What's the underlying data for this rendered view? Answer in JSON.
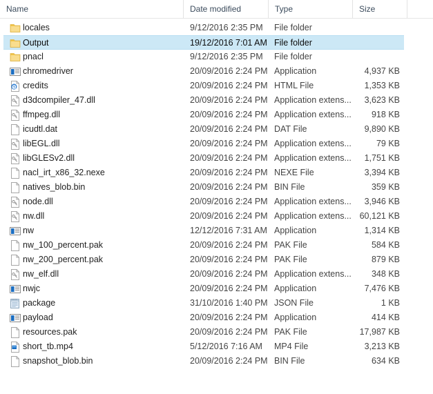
{
  "columns": {
    "name": "Name",
    "date_modified": "Date modified",
    "type": "Type",
    "size": "Size"
  },
  "colors": {
    "selection_fill": "#cce8f6",
    "selection_border": "#b9dff2",
    "folder_icon": "#f7d57f",
    "header_text": "#3b4b5c",
    "row_text": "#1f1f1f",
    "app_icon_blue": "#1b6ec2"
  },
  "files": [
    {
      "name": "locales",
      "date": "9/12/2016 2:35 PM",
      "type": "File folder",
      "size": "",
      "icon": "folder-icon",
      "selected": false
    },
    {
      "name": "Output",
      "date": "19/12/2016 7:01 AM",
      "type": "File folder",
      "size": "",
      "icon": "folder-icon",
      "selected": true
    },
    {
      "name": "pnacl",
      "date": "9/12/2016 2:35 PM",
      "type": "File folder",
      "size": "",
      "icon": "folder-icon",
      "selected": false
    },
    {
      "name": "chromedriver",
      "date": "20/09/2016 2:24 PM",
      "type": "Application",
      "size": "4,937 KB",
      "icon": "application-icon",
      "selected": false
    },
    {
      "name": "credits",
      "date": "20/09/2016 2:24 PM",
      "type": "HTML File",
      "size": "1,353 KB",
      "icon": "html-file-icon",
      "selected": false
    },
    {
      "name": "d3dcompiler_47.dll",
      "date": "20/09/2016 2:24 PM",
      "type": "Application extens...",
      "size": "3,623 KB",
      "icon": "dll-file-icon",
      "selected": false
    },
    {
      "name": "ffmpeg.dll",
      "date": "20/09/2016 2:24 PM",
      "type": "Application extens...",
      "size": "918 KB",
      "icon": "dll-file-icon",
      "selected": false
    },
    {
      "name": "icudtl.dat",
      "date": "20/09/2016 2:24 PM",
      "type": "DAT File",
      "size": "9,890 KB",
      "icon": "blank-file-icon",
      "selected": false
    },
    {
      "name": "libEGL.dll",
      "date": "20/09/2016 2:24 PM",
      "type": "Application extens...",
      "size": "79 KB",
      "icon": "dll-file-icon",
      "selected": false
    },
    {
      "name": "libGLESv2.dll",
      "date": "20/09/2016 2:24 PM",
      "type": "Application extens...",
      "size": "1,751 KB",
      "icon": "dll-file-icon",
      "selected": false
    },
    {
      "name": "nacl_irt_x86_32.nexe",
      "date": "20/09/2016 2:24 PM",
      "type": "NEXE File",
      "size": "3,394 KB",
      "icon": "blank-file-icon",
      "selected": false
    },
    {
      "name": "natives_blob.bin",
      "date": "20/09/2016 2:24 PM",
      "type": "BIN File",
      "size": "359 KB",
      "icon": "blank-file-icon",
      "selected": false
    },
    {
      "name": "node.dll",
      "date": "20/09/2016 2:24 PM",
      "type": "Application extens...",
      "size": "3,946 KB",
      "icon": "dll-file-icon",
      "selected": false
    },
    {
      "name": "nw.dll",
      "date": "20/09/2016 2:24 PM",
      "type": "Application extens...",
      "size": "60,121 KB",
      "icon": "dll-file-icon",
      "selected": false
    },
    {
      "name": "nw",
      "date": "12/12/2016 7:31 AM",
      "type": "Application",
      "size": "1,314 KB",
      "icon": "application-icon",
      "selected": false
    },
    {
      "name": "nw_100_percent.pak",
      "date": "20/09/2016 2:24 PM",
      "type": "PAK File",
      "size": "584 KB",
      "icon": "blank-file-icon",
      "selected": false
    },
    {
      "name": "nw_200_percent.pak",
      "date": "20/09/2016 2:24 PM",
      "type": "PAK File",
      "size": "879 KB",
      "icon": "blank-file-icon",
      "selected": false
    },
    {
      "name": "nw_elf.dll",
      "date": "20/09/2016 2:24 PM",
      "type": "Application extens...",
      "size": "348 KB",
      "icon": "dll-file-icon",
      "selected": false
    },
    {
      "name": "nwjc",
      "date": "20/09/2016 2:24 PM",
      "type": "Application",
      "size": "7,476 KB",
      "icon": "application-icon",
      "selected": false
    },
    {
      "name": "package",
      "date": "31/10/2016 1:40 PM",
      "type": "JSON File",
      "size": "1 KB",
      "icon": "notepad-icon",
      "selected": false
    },
    {
      "name": "payload",
      "date": "20/09/2016 2:24 PM",
      "type": "Application",
      "size": "414 KB",
      "icon": "application-icon",
      "selected": false
    },
    {
      "name": "resources.pak",
      "date": "20/09/2016 2:24 PM",
      "type": "PAK File",
      "size": "17,987 KB",
      "icon": "blank-file-icon",
      "selected": false
    },
    {
      "name": "short_tb.mp4",
      "date": "5/12/2016 7:16 AM",
      "type": "MP4 File",
      "size": "3,213 KB",
      "icon": "media-file-icon",
      "selected": false
    },
    {
      "name": "snapshot_blob.bin",
      "date": "20/09/2016 2:24 PM",
      "type": "BIN File",
      "size": "634 KB",
      "icon": "blank-file-icon",
      "selected": false
    }
  ]
}
